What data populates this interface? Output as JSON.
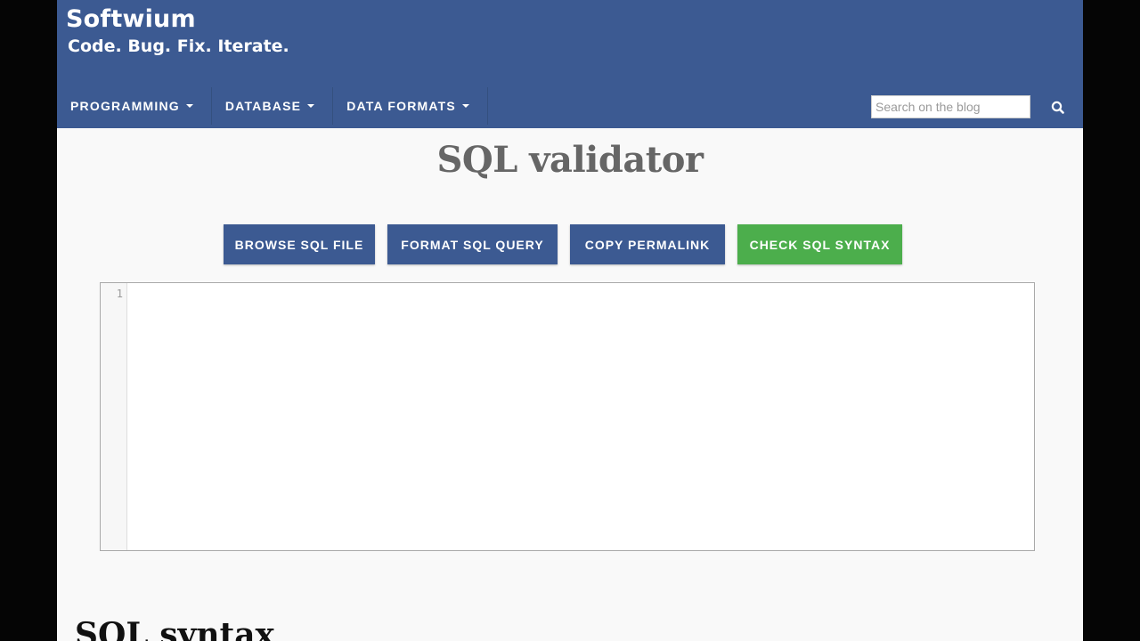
{
  "site": {
    "name": "Softwium",
    "tagline": "Code. Bug. Fix. Iterate."
  },
  "nav": {
    "items": [
      {
        "label": "PROGRAMMING"
      },
      {
        "label": "DATABASE"
      },
      {
        "label": "DATA FORMATS"
      }
    ]
  },
  "search": {
    "placeholder": "Search on the blog",
    "value": "",
    "icon": "search-icon"
  },
  "page": {
    "title": "SQL validator"
  },
  "toolbar": {
    "browse_label": "BROWSE SQL FILE",
    "format_label": "FORMAT SQL QUERY",
    "permalink_label": "COPY PERMALINK",
    "check_label": "CHECK SQL SYNTAX"
  },
  "editor": {
    "line_numbers": [
      "1"
    ],
    "content": ""
  },
  "section": {
    "heading": "SQL syntax"
  },
  "colors": {
    "header": "#3c5a92",
    "primary_button": "#3c5a92",
    "success_button": "#4cae4c"
  }
}
